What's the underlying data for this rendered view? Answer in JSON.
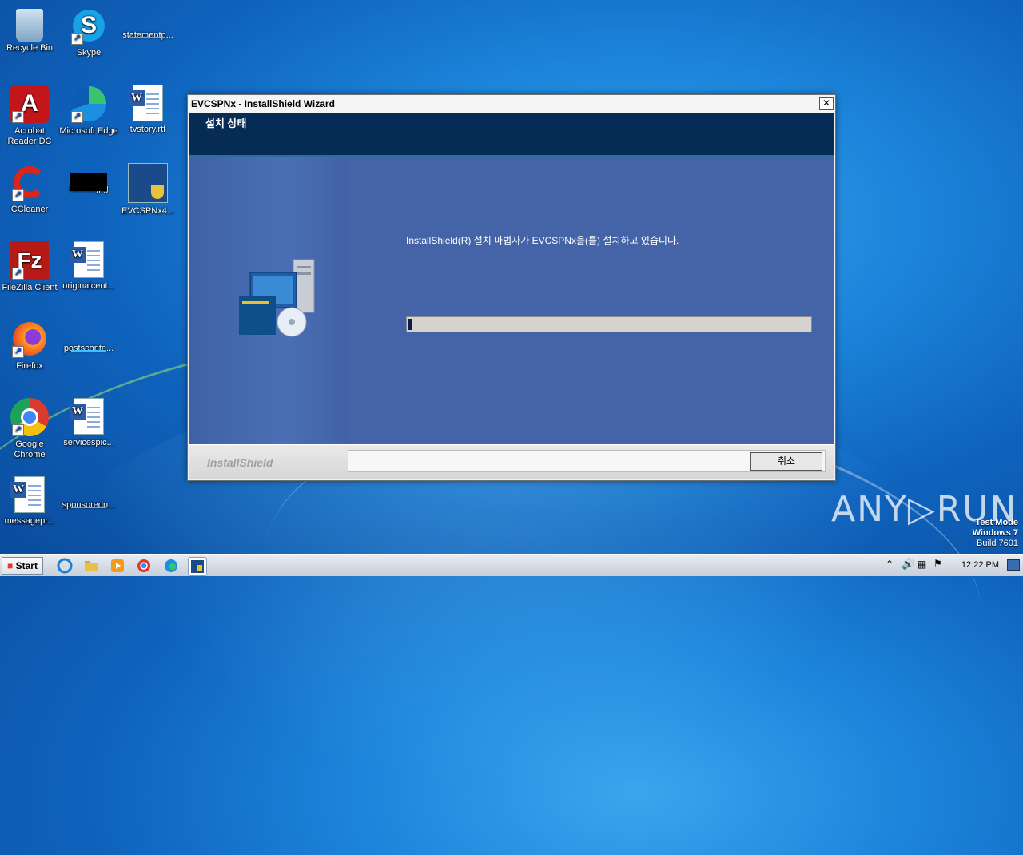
{
  "desktop_icons": [
    {
      "label": "Recycle Bin",
      "icon": "recycle-bin-icon"
    },
    {
      "label": "Skype",
      "icon": "skype-icon"
    },
    {
      "label": "statementp...",
      "icon": "file-icon"
    },
    {
      "label": "Acrobat Reader DC",
      "icon": "acrobat-icon"
    },
    {
      "label": "Microsoft Edge",
      "icon": "edge-icon"
    },
    {
      "label": "tvstory.rtf",
      "icon": "word-doc-icon"
    },
    {
      "label": "CCleaner",
      "icon": "ccleaner-icon"
    },
    {
      "label": "ncless.jpg",
      "icon": "image-file-icon"
    },
    {
      "label": "EVCSPNx4...",
      "icon": "installer-icon"
    },
    {
      "label": "FileZilla Client",
      "icon": "filezilla-icon"
    },
    {
      "label": "originalcent...",
      "icon": "word-doc-icon"
    },
    {
      "label": "Firefox",
      "icon": "firefox-icon"
    },
    {
      "label": "postsconte...",
      "icon": "file-icon"
    },
    {
      "label": "Google Chrome",
      "icon": "chrome-icon"
    },
    {
      "label": "servicespic...",
      "icon": "word-doc-icon"
    },
    {
      "label": "messagepr...",
      "icon": "word-doc-icon"
    },
    {
      "label": "sponsoredn...",
      "icon": "file-icon"
    }
  ],
  "window": {
    "title": "EVCSPNx - InstallShield Wizard",
    "close": "✕",
    "header": "설치 상태",
    "message": "InstallShield(R) 설치 마법사가 EVCSPNx을(를) 설치하고 있습니다.",
    "progress": 0.01,
    "brand": "InstallShield",
    "cancel_label": "취소"
  },
  "watermark": {
    "text": "ANY▷RUN",
    "mode_line1": "Test Mode",
    "mode_line2": "Windows 7",
    "mode_line3": "Build 7601"
  },
  "taskbar": {
    "start_label": "Start",
    "apps": [
      "ie-icon",
      "explorer-icon",
      "media-player-icon",
      "chrome-icon",
      "edge-icon",
      "installer-icon"
    ],
    "clock": "12:22 PM"
  }
}
